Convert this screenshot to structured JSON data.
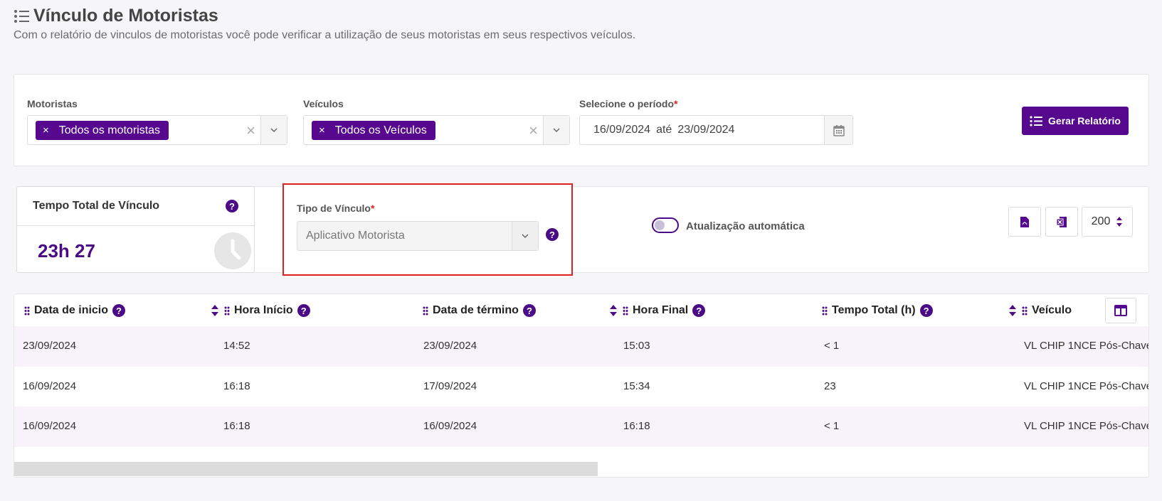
{
  "page": {
    "title": "Vínculo de Motoristas",
    "subtitle": "Com o relatório de vinculos de motoristas você pode verificar a utilização de seus motoristas em seus respectivos veículos."
  },
  "filters": {
    "motoristas_label": "Motoristas",
    "motoristas_tag": "Todos os motoristas",
    "veiculos_label": "Veículos",
    "veiculos_tag": "Todos os Veículos",
    "tag_remove": "×",
    "clear": "×",
    "periodo_label": "Selecione o período",
    "required_mark": "*",
    "date_start": "16/09/2024",
    "date_separator": "até",
    "date_end": "23/09/2024",
    "gerar_label": "Gerar Relatório"
  },
  "summary": {
    "tempo_title": "Tempo Total de Víncul o",
    "tempo_value": "23h 27",
    "help": "?"
  },
  "tipo": {
    "label": "Tipo de Vínculo",
    "selected": "Aplicativo Motorista"
  },
  "toolbar": {
    "auto_update_label": "Atualização automática",
    "auto_update_on": false,
    "page_size": "200"
  },
  "table": {
    "headers": [
      "Data de inicio",
      "Hora Início",
      "Data de término",
      "Hora Final",
      "Tempo Total (h)",
      "Veículo"
    ],
    "rows": [
      [
        "23/09/2024",
        "14:52",
        "23/09/2024",
        "15:03",
        "< 1",
        "VL CHIP 1NCE Pós-Chave"
      ],
      [
        "16/09/2024",
        "16:18",
        "17/09/2024",
        "15:34",
        "23",
        "VL CHIP 1NCE Pós-Chave"
      ],
      [
        "16/09/2024",
        "16:18",
        "16/09/2024",
        "16:18",
        "< 1",
        "VL CHIP 1NCE Pós-Chave"
      ]
    ]
  },
  "colors": {
    "accent": "#56088f",
    "highlight": "#e02020",
    "row_alt": "#f8f3fb"
  }
}
